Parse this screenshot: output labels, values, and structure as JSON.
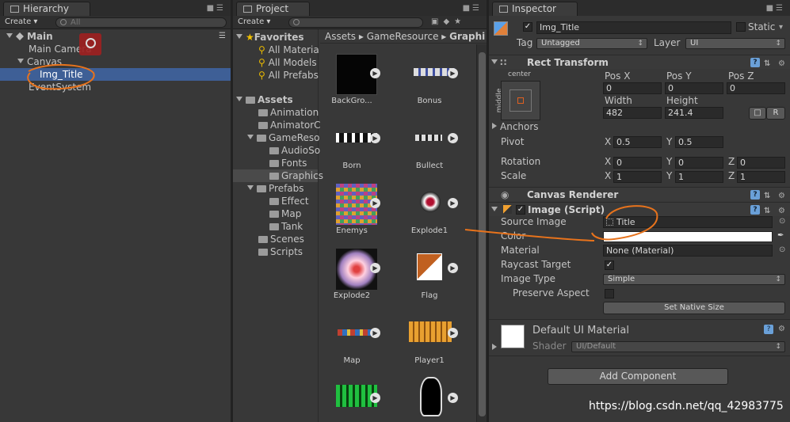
{
  "hierarchy": {
    "tab": "Hierarchy",
    "create": "Create",
    "search_placeholder": "All",
    "scene": "Main",
    "items": [
      "Main Camera",
      "Canvas",
      "Img_Title",
      "EventSystem"
    ]
  },
  "project": {
    "tab": "Project",
    "create": "Create",
    "favorites": {
      "label": "Favorites",
      "items": [
        "All Materia",
        "All Models",
        "All Prefabs"
      ]
    },
    "assets": {
      "label": "Assets",
      "items": [
        "Animation",
        "AnimatorC",
        "GameReso",
        "AudioSo",
        "Fonts",
        "Graphics",
        "Prefabs",
        "Effect",
        "Map",
        "Tank",
        "Scenes",
        "Scripts"
      ]
    },
    "breadcrumb": [
      "Assets",
      "GameResource",
      "Graphi"
    ],
    "tiles": [
      "BackGro...",
      "Bonus",
      "Born",
      "Bullect",
      "Enemys",
      "Explode1",
      "Explode2",
      "Flag",
      "Map",
      "Player1",
      "",
      ""
    ]
  },
  "inspector": {
    "tab": "Inspector",
    "object_name": "Img_Title",
    "static_label": "Static",
    "tag_label": "Tag",
    "tag_value": "Untagged",
    "layer_label": "Layer",
    "layer_value": "UI",
    "rect": {
      "title": "Rect Transform",
      "anchor_h": "center",
      "anchor_v": "middle",
      "posx_label": "Pos X",
      "posy_label": "Pos Y",
      "posz_label": "Pos Z",
      "posx": "0",
      "posy": "0",
      "posz": "0",
      "width_label": "Width",
      "height_label": "Height",
      "width": "482",
      "height": "241.4",
      "r_btn": "R",
      "anchors": "Anchors",
      "pivot": "Pivot",
      "pivot_x": "0.5",
      "pivot_y": "0.5",
      "rotation": "Rotation",
      "rot_x": "0",
      "rot_y": "0",
      "rot_z": "0",
      "scale": "Scale",
      "scale_x": "1",
      "scale_y": "1",
      "scale_z": "1",
      "x": "X",
      "y": "Y",
      "z": "Z"
    },
    "canvas_renderer": "Canvas Renderer",
    "image": {
      "title": "Image (Script)",
      "source_label": "Source Image",
      "source_value": "Title",
      "color_label": "Color",
      "material_label": "Material",
      "material_value": "None (Material)",
      "raycast_label": "Raycast Target",
      "type_label": "Image Type",
      "type_value": "Simple",
      "preserve_label": "Preserve Aspect",
      "native_btn": "Set Native Size"
    },
    "material": {
      "name": "Default UI Material",
      "shader_label": "Shader",
      "shader_value": "UI/Default"
    },
    "add_component": "Add Component",
    "watermark": "https://blog.csdn.net/qq_42983775"
  },
  "colors": {
    "selection": "#3e5f96",
    "annotation": "#e8731c"
  }
}
